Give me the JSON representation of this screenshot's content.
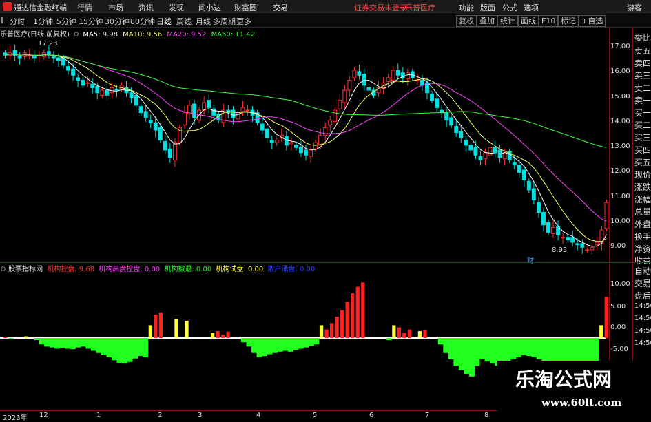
{
  "titlebar": {
    "app_name": "通达信金融终端",
    "menus": [
      "行情",
      "市场",
      "资讯",
      "发现",
      "问小达",
      "财富圈",
      "交易"
    ],
    "warning": "证券交易未登录",
    "stock": "乐普医疗",
    "right_items": [
      "功能",
      "版面",
      "公式",
      "选项"
    ],
    "guest": "游客"
  },
  "toolbar": {
    "periods": [
      "分时",
      "1分钟",
      "5分钟",
      "15分钟",
      "30分钟",
      "60分钟",
      "日线",
      "周线",
      "月线",
      "多周期",
      "更多"
    ],
    "selected": "日线",
    "buttons": [
      "复权",
      "叠加",
      "统计",
      "画线",
      "F10",
      "标记",
      "+自选"
    ]
  },
  "main_info": {
    "stock_label": "乐普医疗(日线 前复权)",
    "ma5": "MA5: 9.98",
    "ma10": "MA10: 9.56",
    "ma20": "MA20: 9.52",
    "ma60": "MA60: 11.42",
    "high_label": "17.23",
    "low_label": "8.93",
    "markers": [
      "财"
    ]
  },
  "price_axis": [
    "17.00",
    "16.00",
    "15.00",
    "14.00",
    "13.00",
    "12.00",
    "11.00",
    "10.00",
    "9.00"
  ],
  "right_panel": [
    "委比",
    "卖五",
    "卖四",
    "卖三",
    "卖二",
    "卖一",
    "买一",
    "买二",
    "买三",
    "买四",
    "买五",
    "现价",
    "涨跌",
    "涨幅",
    "总量",
    "外盘",
    "换手",
    "净资",
    "收益",
    "自动",
    "交易",
    "盘后"
  ],
  "indicator": {
    "name": "股票指标网",
    "items": [
      {
        "label": "机构控盘: 9.68",
        "color": "#ff3030"
      },
      {
        "label": "机构高度控盘: 0.00",
        "color": "#ff40ff"
      },
      {
        "label": "机构撤退: 0.00",
        "color": "#20ff20"
      },
      {
        "label": "机构试盘: 0.00",
        "color": "#ffff40"
      },
      {
        "label": "散户涌盘: 0.00",
        "color": "#3040ff"
      }
    ],
    "axis": [
      "10.00",
      "5.00",
      "0.00",
      "-5.00"
    ],
    "axis_right": [
      "14:50",
      "14:50",
      "14:50",
      "14:50"
    ]
  },
  "date_axis": [
    "2023年",
    "12",
    "1",
    "2",
    "3",
    "4",
    "5",
    "6",
    "7",
    "8"
  ],
  "watermark": {
    "line1": "乐淘公式网",
    "line2": "www.60lt.com"
  },
  "colors": {
    "up": "#ff3030",
    "down": "#00e0e0",
    "ma5": "#ffffff",
    "ma10": "#ffff60",
    "ma20": "#ff40ff",
    "ma60": "#40ff40",
    "border": "#7a1010"
  },
  "chart_data": {
    "type": "candlestick",
    "ylim": [
      8.5,
      17.5
    ],
    "close": [
      16.8,
      16.9,
      16.8,
      16.7,
      16.9,
      16.8,
      16.7,
      16.8,
      16.9,
      16.85,
      16.7,
      16.6,
      16.4,
      16.2,
      16.0,
      15.8,
      15.6,
      15.7,
      15.5,
      15.3,
      15.4,
      15.2,
      15.5,
      15.4,
      15.6,
      15.3,
      15.1,
      14.8,
      14.5,
      14.3,
      14.1,
      13.8,
      13.4,
      13.0,
      12.7,
      13.3,
      13.9,
      14.5,
      14.8,
      14.3,
      14.6,
      14.9,
      14.7,
      14.4,
      14.2,
      14.6,
      14.5,
      14.3,
      14.5,
      14.7,
      14.6,
      14.4,
      14.1,
      13.8,
      13.5,
      13.3,
      13.4,
      13.6,
      13.2,
      13.3,
      13.1,
      12.9,
      12.8,
      13.0,
      13.3,
      13.6,
      13.9,
      14.2,
      14.6,
      15.0,
      15.4,
      15.8,
      16.2,
      16.0,
      15.6,
      15.4,
      15.2,
      15.5,
      15.7,
      15.9,
      16.2,
      16.0,
      15.9,
      16.1,
      15.9,
      15.8,
      15.6,
      15.3,
      15.0,
      14.7,
      14.5,
      14.2,
      14.0,
      13.7,
      13.5,
      13.2,
      13.0,
      12.8,
      12.6,
      12.9,
      13.1,
      12.9,
      12.7,
      12.9,
      12.6,
      12.4,
      12.1,
      11.8,
      11.4,
      11.0,
      10.5,
      10.0,
      9.7,
      9.9,
      9.6,
      9.5,
      9.4,
      9.3,
      9.2,
      9.1,
      9.0,
      9.1,
      9.3,
      9.8,
      10.9
    ],
    "indicator_values": [
      0.3,
      -0.2,
      0,
      0,
      0.4,
      0,
      -0.5,
      -1.5,
      -2.0,
      -2.2,
      -2.5,
      -2.3,
      -2.5,
      -2.6,
      -2.2,
      -2.0,
      -2.5,
      -3.0,
      -3.5,
      -4.0,
      -4.5,
      -5.2,
      -5.8,
      -6.0,
      -5.6,
      -4.8,
      -4.2,
      -4.5,
      3.0,
      5.5,
      6.0,
      0,
      0,
      4.5,
      0,
      4.0,
      0,
      0,
      0,
      0,
      1.2,
      1.6,
      0.8,
      1.5,
      0,
      0,
      -1.0,
      -2.0,
      -3.5,
      -4.5,
      -4.2,
      -3.8,
      -3.5,
      -3.2,
      -3.0,
      -3.2,
      -2.8,
      -2.5,
      -2.2,
      -1.8,
      -1.5,
      3.0,
      2.0,
      3.5,
      5.0,
      6.5,
      8.5,
      10.5,
      12.0,
      13.0,
      0,
      0,
      0,
      0,
      -0.5,
      3.0,
      2.5,
      1.2,
      2.0,
      0,
      1.6,
      1.8,
      0,
      0,
      -1.5,
      -3.5,
      -5.0,
      -6.5,
      -7.5,
      -8.5,
      -9.0,
      -6.5,
      -5.0,
      -5.5,
      -6.0,
      -6.5,
      -6.0,
      -5.5,
      -5.0,
      -4.5,
      -4.0,
      -4.2,
      -4.5,
      -5.0,
      -6.0,
      -7.0,
      -7.5,
      -8.0,
      -8.0,
      -8.0,
      -8.0,
      -8.0,
      -7.5,
      -6.5,
      -5.5,
      3.0,
      9.68
    ]
  }
}
